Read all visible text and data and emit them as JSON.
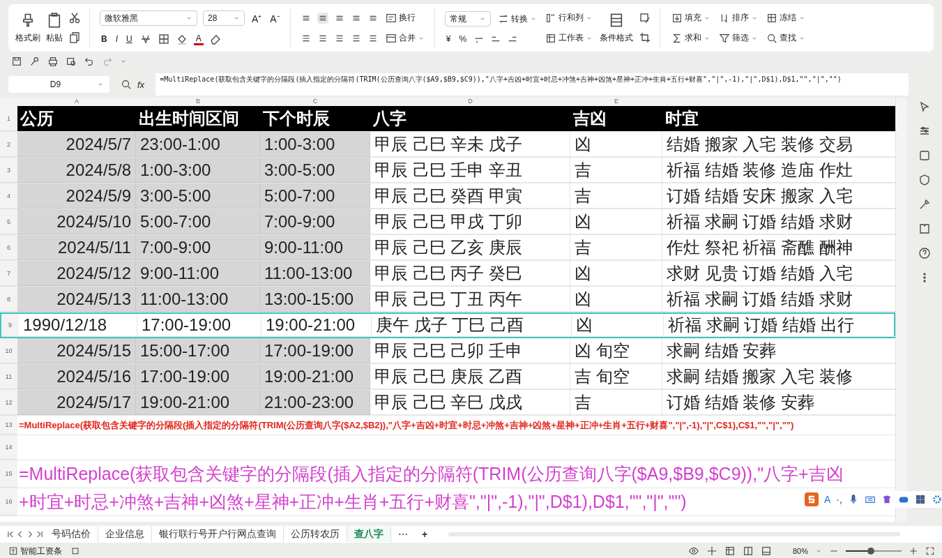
{
  "clipboard": {
    "format_painter": "格式刷",
    "paste": "粘贴"
  },
  "font": {
    "family": "微软雅黑",
    "size": "28",
    "grow": "A⁺",
    "shrink": "A⁻",
    "styles": [
      "B",
      "I",
      "U"
    ],
    "color_letter": "A"
  },
  "alignment": {
    "wrap": "换行",
    "merge": "合并"
  },
  "number_format": {
    "format": "常规",
    "currency": "¥",
    "percent": "%"
  },
  "cells_group": {
    "convert": "转换",
    "rows_columns": "行和列",
    "worksheet": "工作表",
    "conditional_format": "条件格式"
  },
  "editing": {
    "fill": "填充",
    "sort": "排序",
    "freeze": "冻结",
    "sum": "求和",
    "filter": "筛选",
    "find": "查找"
  },
  "formula_bar": {
    "cell_ref": "D9",
    "fx": "fx",
    "formula": "=MultiReplace(获取包含关键字的分隔段(插入指定的分隔符(TRIM(公历查询八字($A9,$B9,$C9)),\"八字+吉凶+时宜+时忌+冲煞+吉神+凶煞+星神+正冲+生肖+五行+财喜\",\"|\",-1),\"|\",D$1),D$1,\"\",\"|\",\"\")"
  },
  "columns": [
    "A",
    "B",
    "C",
    "D",
    "E"
  ],
  "header_row": {
    "row_number": "1",
    "cells": [
      "公历",
      "出生时间区间",
      "下个时辰",
      "八字",
      "吉凶",
      "时宜"
    ]
  },
  "rows": [
    {
      "row_number": "2",
      "highlighted": false,
      "cells": [
        "2024/5/7",
        "23:00-1:00",
        "1:00-3:00",
        "甲辰 己巳 辛未 戊子",
        "凶",
        "结婚 搬家 入宅 装修 交易"
      ]
    },
    {
      "row_number": "3",
      "highlighted": false,
      "cells": [
        "2024/5/8",
        "1:00-3:00",
        "3:00-5:00",
        "甲辰 己巳 壬申 辛丑",
        "吉",
        "祈福 结婚 装修 造庙 作灶"
      ]
    },
    {
      "row_number": "4",
      "highlighted": false,
      "cells": [
        "2024/5/9",
        "3:00-5:00",
        "5:00-7:00",
        "甲辰 己巳 癸酉 甲寅",
        "吉",
        "订婚 结婚 安床 搬家 入宅"
      ]
    },
    {
      "row_number": "5",
      "highlighted": false,
      "cells": [
        "2024/5/10",
        "5:00-7:00",
        "7:00-9:00",
        "甲辰 己巳 甲戌 丁卯",
        "凶",
        "祈福 求嗣 订婚 结婚 求财"
      ]
    },
    {
      "row_number": "6",
      "highlighted": false,
      "cells": [
        "2024/5/11",
        "7:00-9:00",
        "9:00-11:00",
        "甲辰 己巳 乙亥 庚辰",
        "吉",
        "作灶 祭祀 祈福 斋醮 酬神"
      ]
    },
    {
      "row_number": "7",
      "highlighted": false,
      "cells": [
        "2024/5/12",
        "9:00-11:00",
        "11:00-13:00",
        "甲辰 己巳 丙子 癸巳",
        "凶",
        "求财 见贵 订婚 结婚 入宅"
      ]
    },
    {
      "row_number": "8",
      "highlighted": false,
      "cells": [
        "2024/5/13",
        "11:00-13:00",
        "13:00-15:00",
        "甲辰 己巳 丁丑 丙午",
        "凶",
        "祈福 求嗣 订婚 结婚 求财"
      ]
    },
    {
      "row_number": "9",
      "highlighted": true,
      "cells": [
        "1990/12/18",
        "17:00-19:00",
        "19:00-21:00",
        "庚午 戊子 丁巳 己酉",
        "凶",
        "祈福 求嗣 订婚 结婚 出行"
      ]
    },
    {
      "row_number": "10",
      "highlighted": false,
      "cells": [
        "2024/5/15",
        "15:00-17:00",
        "17:00-19:00",
        "甲辰 己巳 己卯 壬申",
        "凶 旬空",
        "求嗣 结婚 安葬"
      ]
    },
    {
      "row_number": "11",
      "highlighted": false,
      "cells": [
        "2024/5/16",
        "17:00-19:00",
        "19:00-21:00",
        "甲辰 己巳 庚辰 乙酉",
        "吉 旬空",
        "求嗣 结婚 搬家 入宅 装修"
      ]
    },
    {
      "row_number": "12",
      "highlighted": false,
      "cells": [
        "2024/5/17",
        "19:00-21:00",
        "21:00-23:00",
        "甲辰 己巳 辛巳 戊戌",
        "吉",
        "订婚 结婚 装修 安葬"
      ]
    }
  ],
  "formula_row": {
    "row_number": "13",
    "text": "=MultiReplace(获取包含关键字的分隔段(插入指定的分隔符(TRIM(公历查询八字($A2,$B2)),\"八字+吉凶+时宜+时忌+冲煞+吉神+凶煞+星神+正冲+生肖+五行+财喜\",\"|\",-1),\"|\",C$1),C$1,\"\",\"|\",\"\")"
  },
  "blank_row": "14",
  "big_formula": [
    {
      "row_number": "15",
      "text": "=MultiReplace(获取包含关键字的分隔段(插入指定的分隔符(TRIM(公历查询八字($A9,$B9,$C9)),\"八字+吉凶"
    },
    {
      "row_number": "16",
      "text": "+时宜+时忌+冲煞+吉神+凶煞+星神+正冲+生肖+五行+财喜\",\"|\",-1),\"|\",D$1),D$1,\"\",\"|\",\"\")"
    }
  ],
  "sheet_tabs": [
    {
      "label": "号码估价",
      "selected": false
    },
    {
      "label": "企业信息",
      "selected": false
    },
    {
      "label": "银行联行号开户行网点查询",
      "selected": false
    },
    {
      "label": "公历转农历",
      "selected": false
    },
    {
      "label": "查八字",
      "selected": true
    }
  ],
  "tab_more": "⋯",
  "tab_add": "+",
  "status_bar": {
    "payroll": "智能工资条",
    "zoom": "80%",
    "zoom_slider": {
      "level": 0.45
    }
  },
  "ime_toolbar": {
    "letter": "A",
    "punctuation": "·,"
  }
}
